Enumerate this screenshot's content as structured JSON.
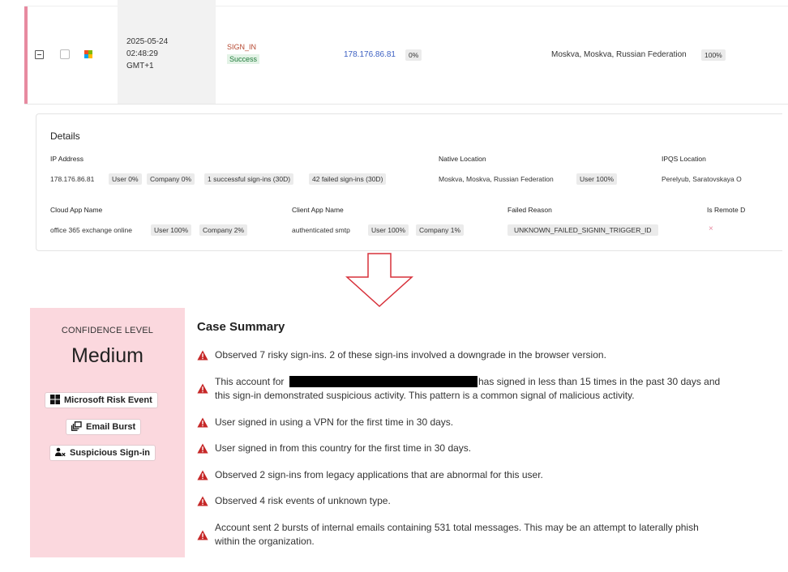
{
  "event_row": {
    "date": "2025-05-24",
    "time": "02:48:29",
    "tz": "GMT+1",
    "event_type": "SIGN_IN",
    "event_status": "Success",
    "ip": "178.176.86.81",
    "ip_score": "0%",
    "location": "Moskva, Moskva, Russian Federation",
    "location_score": "100%",
    "ms_colors": [
      "#f25022",
      "#7fba00",
      "#00a4ef",
      "#ffb900"
    ]
  },
  "details": {
    "title": "Details",
    "ip_label": "IP Address",
    "ip_value": "178.176.86.81",
    "ip_chips": [
      "User 0%",
      "Company 0%",
      "1 successful sign-ins (30D)",
      "42 failed sign-ins (30D)"
    ],
    "native_label": "Native Location",
    "native_value": "Moskva, Moskva, Russian Federation",
    "native_chip": "User 100%",
    "ipqs_label": "IPQS Location",
    "ipqs_value": "Perelyub, Saratovskaya O",
    "cloud_label": "Cloud App Name",
    "cloud_value": "office 365 exchange online",
    "cloud_chips": [
      "User 100%",
      "Company 2%"
    ],
    "client_label": "Client App Name",
    "client_value": "authenticated smtp",
    "client_chips": [
      "User 100%",
      "Company 1%"
    ],
    "failed_label": "Failed Reason",
    "failed_value": "UNKNOWN_FAILED_SIGNIN_TRIGGER_ID",
    "remote_label": "Is Remote D",
    "remote_value": "×"
  },
  "confidence": {
    "label": "CONFIDENCE LEVEL",
    "value": "Medium",
    "tags": [
      {
        "label": "Microsoft Risk Event",
        "icon": "microsoft-logo-icon"
      },
      {
        "label": "Email Burst",
        "icon": "email-burst-icon"
      },
      {
        "label": "Suspicious Sign-in",
        "icon": "suspicious-user-icon"
      }
    ],
    "panel_color": "#fbd8de"
  },
  "summary": {
    "title": "Case Summary",
    "items": [
      {
        "text": "Observed 7 risky sign-ins. 2 of these sign-ins involved a downgrade in the browser version."
      },
      {
        "text_before": "This account for",
        "text_after": "has signed in less than 15 times in the past 30 days and",
        "text_line2": "this sign-in demonstrated suspicious activity. This pattern is a common signal of malicious activity."
      },
      {
        "text": "User signed in using a VPN for the first time in 30 days."
      },
      {
        "text": "User signed in from this country for the first time in 30 days."
      },
      {
        "text": "Observed 2 sign-ins from legacy applications that are abnormal for this user."
      },
      {
        "text": "Observed 4 risk events of unknown type."
      },
      {
        "text": "Account sent 2 bursts of internal emails containing 531 total messages. This may be an attempt to laterally phish",
        "text_line2": "within the organization."
      }
    ],
    "warn_color": "#c62828"
  }
}
